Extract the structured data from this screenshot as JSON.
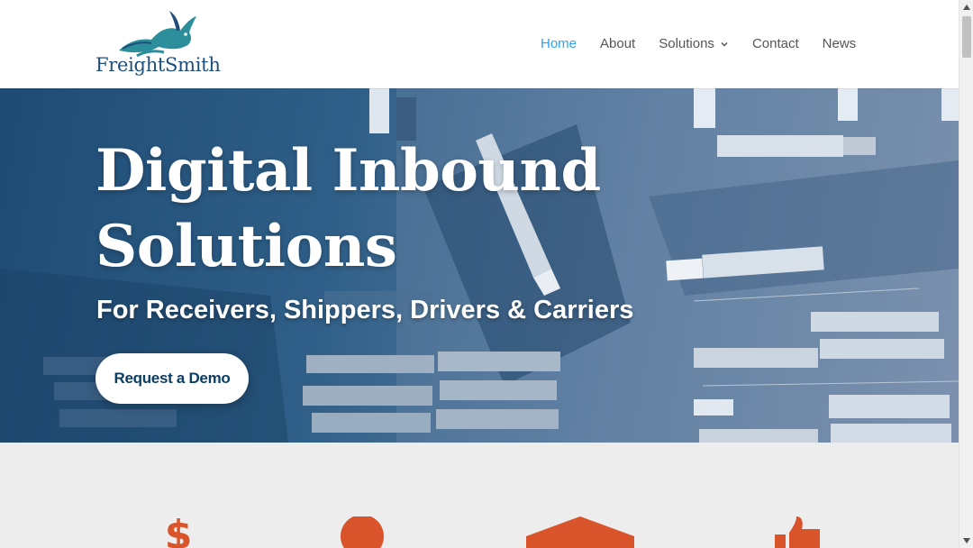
{
  "header": {
    "logo_text": "FreightSmith",
    "nav": [
      {
        "label": "Home",
        "active": true
      },
      {
        "label": "About",
        "active": false
      },
      {
        "label": "Solutions",
        "active": false,
        "dropdown": true
      },
      {
        "label": "Contact",
        "active": false
      },
      {
        "label": "News",
        "active": false
      }
    ]
  },
  "hero": {
    "title_line1": "Digital Inbound",
    "title_line2": "Solutions",
    "subtitle": "For Receivers, Shippers, Drivers & Carriers",
    "cta_label": "Request a Demo"
  },
  "features": {
    "icons": [
      "dollar-icon",
      "person-icon",
      "house-icon",
      "thumbs-up-icon"
    ],
    "icon_color": "#d9532b"
  },
  "colors": {
    "accent": "#2ea3f2",
    "brand_navy": "#1f4e7a",
    "button_text": "#0c3d63",
    "feature_bg": "#ededed"
  }
}
